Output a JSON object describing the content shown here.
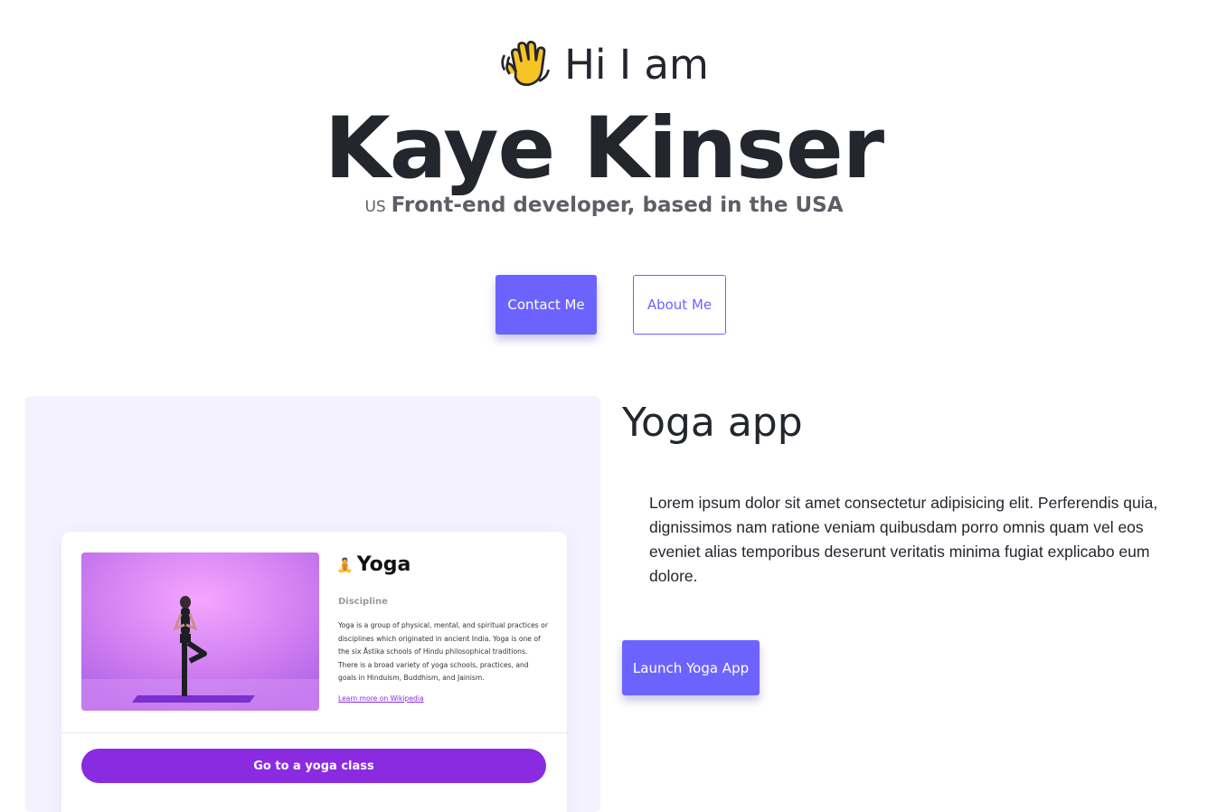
{
  "hero": {
    "wave_icon": "waving-hand-icon",
    "greeting": "Hi I am",
    "name": "Kaye Kinser",
    "flag_text": "US",
    "tagline": "Front-end developer, based in the USA"
  },
  "actions": {
    "contact_label": "Contact Me",
    "about_label": "About Me"
  },
  "project": {
    "title": "Yoga app",
    "description": "Lorem ipsum dolor sit amet consectetur adipisicing elit. Perferendis quia, dignissimos nam ratione veniam quibusdam porro omnis quam vel eos eveniet alias temporibus deserunt veritatis minima fugiat explicabo eum dolore.",
    "launch_label": "Launch Yoga App",
    "preview": {
      "icon": "lotus-position-icon",
      "title": "Yoga",
      "subtitle": "Discipline",
      "description": "Yoga is a group of physical, mental, and spiritual practices or disciplines which originated in ancient India. Yoga is one of the six Āstika schools of Hindu philosophical traditions. There is a broad variety of yoga schools, practices, and goals in Hinduism, Buddhism, and Jainism.",
      "link": "Learn more on Wikipedia",
      "cta": "Go to a yoga class"
    }
  },
  "colors": {
    "accent": "#6c63ff",
    "preview_purple": "#8a2be2",
    "card_bg": "#f4f2ff",
    "text": "#23262d"
  }
}
